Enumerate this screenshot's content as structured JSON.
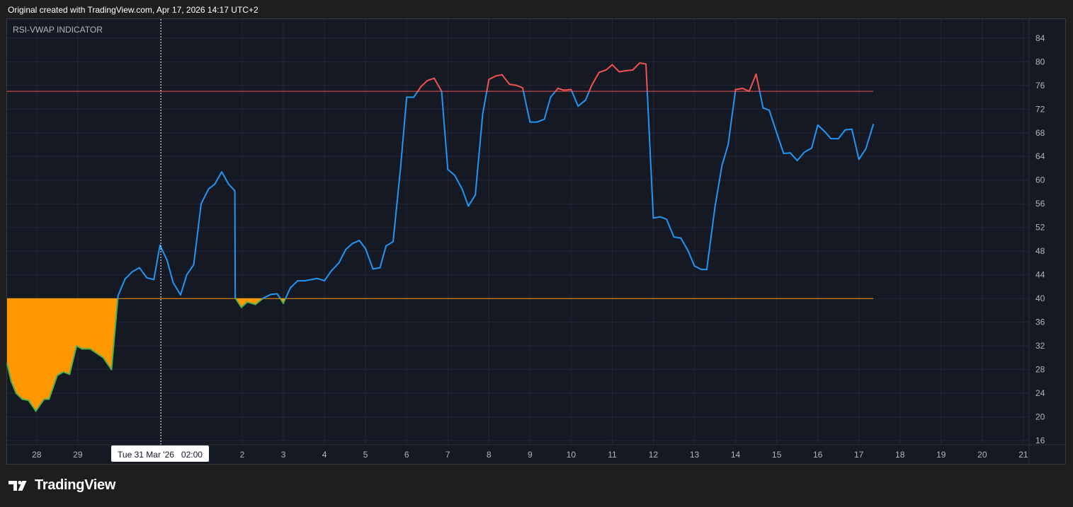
{
  "header": {
    "text": "Original created with TradingView.com, Apr 17, 2026 14:17 UTC+2"
  },
  "brand": {
    "name": "TradingView"
  },
  "colors": {
    "background": "#151924",
    "line_blue": "#2196f3",
    "line_red": "#ef5350",
    "line_green": "#4caf50",
    "fill_orange": "#ff9800",
    "upper_level": "#ef5350",
    "lower_level": "#ff9800",
    "grid": "#232734",
    "text": "#b2b5be"
  },
  "chart_data": {
    "type": "line",
    "title": "RSI-VWAP INDICATOR",
    "x_unit": "day index (0 = Mar 28)",
    "x_tick_labels": [
      {
        "x": 0,
        "label": "28"
      },
      {
        "x": 1,
        "label": "29"
      },
      {
        "x": 5,
        "label": "2"
      },
      {
        "x": 6,
        "label": "3"
      },
      {
        "x": 7,
        "label": "4"
      },
      {
        "x": 8,
        "label": "5"
      },
      {
        "x": 9,
        "label": "6"
      },
      {
        "x": 10,
        "label": "7"
      },
      {
        "x": 11,
        "label": "8"
      },
      {
        "x": 12,
        "label": "9"
      },
      {
        "x": 13,
        "label": "10"
      },
      {
        "x": 14,
        "label": "11"
      },
      {
        "x": 15,
        "label": "12"
      },
      {
        "x": 16,
        "label": "13"
      },
      {
        "x": 17,
        "label": "14"
      },
      {
        "x": 18,
        "label": "15"
      },
      {
        "x": 19,
        "label": "16"
      },
      {
        "x": 20,
        "label": "17"
      },
      {
        "x": 21,
        "label": "18"
      },
      {
        "x": 22,
        "label": "19"
      },
      {
        "x": 23,
        "label": "20"
      },
      {
        "x": 24,
        "label": "21"
      }
    ],
    "crosshair": {
      "x": 3.02,
      "label": "Tue 31 Mar '26   02:00"
    },
    "y_ticks": [
      16,
      20,
      24,
      28,
      32,
      36,
      40,
      44,
      48,
      52,
      56,
      60,
      64,
      68,
      72,
      76,
      80,
      84
    ],
    "ylim": [
      15.3,
      87.2
    ],
    "xlim": [
      -0.72,
      24.14
    ],
    "overbought": 75,
    "oversold": 40,
    "series": [
      {
        "points": [
          [
            -0.72,
            29
          ],
          [
            -0.62,
            26
          ],
          [
            -0.5,
            24
          ],
          [
            -0.35,
            23
          ],
          [
            -0.2,
            22.8
          ],
          [
            -0.02,
            21
          ],
          [
            0.18,
            23
          ],
          [
            0.3,
            23
          ],
          [
            0.5,
            27
          ],
          [
            0.65,
            27.6
          ],
          [
            0.8,
            27.2
          ],
          [
            0.97,
            32
          ],
          [
            1.1,
            31.5
          ],
          [
            1.3,
            31.5
          ],
          [
            1.62,
            30
          ],
          [
            1.82,
            28
          ],
          [
            1.98,
            40.5
          ],
          [
            2.15,
            43.3
          ],
          [
            2.32,
            44.5
          ],
          [
            2.5,
            45.2
          ],
          [
            2.68,
            43.5
          ],
          [
            2.85,
            43.2
          ],
          [
            3.0,
            49
          ],
          [
            3.17,
            46.5
          ],
          [
            3.32,
            42.7
          ],
          [
            3.5,
            40.6
          ],
          [
            3.65,
            44
          ],
          [
            3.82,
            45.7
          ],
          [
            4.0,
            56
          ],
          [
            4.18,
            58.5
          ],
          [
            4.33,
            59.3
          ],
          [
            4.5,
            61.4
          ],
          [
            4.67,
            59.3
          ],
          [
            4.82,
            58.2
          ],
          [
            4.83,
            40.1
          ],
          [
            4.98,
            38.5
          ],
          [
            5.12,
            39.4
          ],
          [
            5.32,
            39
          ],
          [
            5.52,
            40.1
          ],
          [
            5.7,
            40.7
          ],
          [
            5.85,
            40.8
          ],
          [
            6.0,
            39.2
          ],
          [
            6.17,
            41.8
          ],
          [
            6.35,
            43
          ],
          [
            6.52,
            43
          ],
          [
            6.68,
            43.2
          ],
          [
            6.82,
            43.4
          ],
          [
            7.0,
            43
          ],
          [
            7.17,
            44.7
          ],
          [
            7.35,
            46
          ],
          [
            7.52,
            48.3
          ],
          [
            7.68,
            49.3
          ],
          [
            7.85,
            49.8
          ],
          [
            8.0,
            48.4
          ],
          [
            8.18,
            45
          ],
          [
            8.35,
            45.2
          ],
          [
            8.5,
            48.9
          ],
          [
            8.67,
            49.6
          ],
          [
            8.85,
            62
          ],
          [
            9.0,
            74
          ],
          [
            9.17,
            74
          ],
          [
            9.35,
            75.8
          ],
          [
            9.5,
            76.8
          ],
          [
            9.67,
            77.2
          ],
          [
            9.85,
            75
          ],
          [
            10.0,
            61.8
          ],
          [
            10.17,
            60.8
          ],
          [
            10.35,
            58.5
          ],
          [
            10.5,
            55.6
          ],
          [
            10.67,
            57.5
          ],
          [
            10.85,
            71.2
          ],
          [
            11.0,
            77
          ],
          [
            11.17,
            77.6
          ],
          [
            11.32,
            77.8
          ],
          [
            11.5,
            76.2
          ],
          [
            11.67,
            76
          ],
          [
            11.82,
            75.6
          ],
          [
            12.0,
            69.8
          ],
          [
            12.17,
            69.8
          ],
          [
            12.35,
            70.3
          ],
          [
            12.5,
            74
          ],
          [
            12.68,
            75.5
          ],
          [
            12.82,
            75.2
          ],
          [
            13.0,
            75.3
          ],
          [
            13.17,
            72.5
          ],
          [
            13.35,
            73.5
          ],
          [
            13.5,
            76
          ],
          [
            13.68,
            78.2
          ],
          [
            13.85,
            78.6
          ],
          [
            14.0,
            79.5
          ],
          [
            14.17,
            78.3
          ],
          [
            14.35,
            78.5
          ],
          [
            14.5,
            78.6
          ],
          [
            14.67,
            79.8
          ],
          [
            14.82,
            79.6
          ],
          [
            15.0,
            53.6
          ],
          [
            15.17,
            53.8
          ],
          [
            15.32,
            53.4
          ],
          [
            15.5,
            50.4
          ],
          [
            15.67,
            50.2
          ],
          [
            15.85,
            48
          ],
          [
            16.0,
            45.5
          ],
          [
            16.17,
            44.9
          ],
          [
            16.3,
            44.9
          ],
          [
            16.5,
            55.5
          ],
          [
            16.67,
            62.5
          ],
          [
            16.82,
            66
          ],
          [
            17.0,
            75.3
          ],
          [
            17.17,
            75.5
          ],
          [
            17.33,
            75
          ],
          [
            17.5,
            77.9
          ],
          [
            17.67,
            72.2
          ],
          [
            17.82,
            71.8
          ],
          [
            18.0,
            68
          ],
          [
            18.17,
            64.5
          ],
          [
            18.33,
            64.6
          ],
          [
            18.5,
            63.3
          ],
          [
            18.67,
            64.7
          ],
          [
            18.85,
            65.4
          ],
          [
            19.0,
            69.3
          ],
          [
            19.17,
            68.2
          ],
          [
            19.32,
            67
          ],
          [
            19.5,
            67
          ],
          [
            19.67,
            68.5
          ],
          [
            19.83,
            68.6
          ],
          [
            20.0,
            63.5
          ],
          [
            20.17,
            65.3
          ],
          [
            20.35,
            69.4
          ]
        ]
      }
    ],
    "grid": true
  }
}
